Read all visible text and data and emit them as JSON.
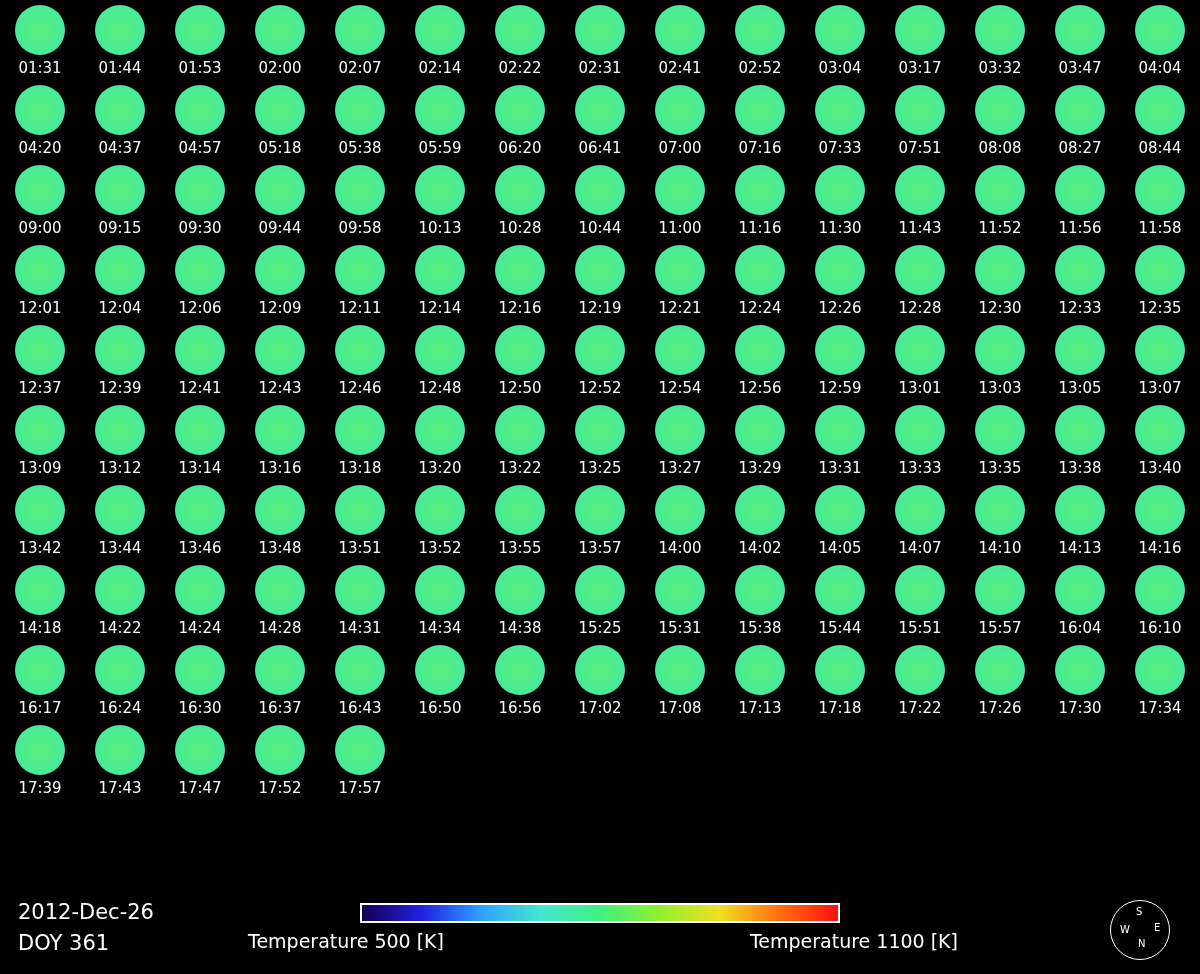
{
  "frame_times": [
    "01:31",
    "01:44",
    "01:53",
    "02:00",
    "02:07",
    "02:14",
    "02:22",
    "02:31",
    "02:41",
    "02:52",
    "03:04",
    "03:17",
    "03:32",
    "03:47",
    "04:04",
    "04:20",
    "04:37",
    "04:57",
    "05:18",
    "05:38",
    "05:59",
    "06:20",
    "06:41",
    "07:00",
    "07:16",
    "07:33",
    "07:51",
    "08:08",
    "08:27",
    "08:44",
    "09:00",
    "09:15",
    "09:30",
    "09:44",
    "09:58",
    "10:13",
    "10:28",
    "10:44",
    "11:00",
    "11:16",
    "11:30",
    "11:43",
    "11:52",
    "11:56",
    "11:58",
    "12:01",
    "12:04",
    "12:06",
    "12:09",
    "12:11",
    "12:14",
    "12:16",
    "12:19",
    "12:21",
    "12:24",
    "12:26",
    "12:28",
    "12:30",
    "12:33",
    "12:35",
    "12:37",
    "12:39",
    "12:41",
    "12:43",
    "12:46",
    "12:48",
    "12:50",
    "12:52",
    "12:54",
    "12:56",
    "12:59",
    "13:01",
    "13:03",
    "13:05",
    "13:07",
    "13:09",
    "13:12",
    "13:14",
    "13:16",
    "13:18",
    "13:20",
    "13:22",
    "13:25",
    "13:27",
    "13:29",
    "13:31",
    "13:33",
    "13:35",
    "13:38",
    "13:40",
    "13:42",
    "13:44",
    "13:46",
    "13:48",
    "13:51",
    "13:52",
    "13:55",
    "13:57",
    "14:00",
    "14:02",
    "14:05",
    "14:07",
    "14:10",
    "14:13",
    "14:16",
    "14:18",
    "14:22",
    "14:24",
    "14:28",
    "14:31",
    "14:34",
    "14:38",
    "15:25",
    "15:31",
    "15:38",
    "15:44",
    "15:51",
    "15:57",
    "16:04",
    "16:10",
    "16:17",
    "16:24",
    "16:30",
    "16:37",
    "16:43",
    "16:50",
    "16:56",
    "17:02",
    "17:08",
    "17:13",
    "17:18",
    "17:22",
    "17:26",
    "17:30",
    "17:34",
    "17:39",
    "17:43",
    "17:47",
    "17:52",
    "17:57"
  ],
  "date": "2012-Dec-26",
  "doy": "DOY 361",
  "colorbar": {
    "min_label": "Temperature 500 [K]",
    "max_label": "Temperature 1100 [K]"
  },
  "compass": {
    "top": "S",
    "left": "W",
    "right": "E",
    "bottom": "N"
  }
}
